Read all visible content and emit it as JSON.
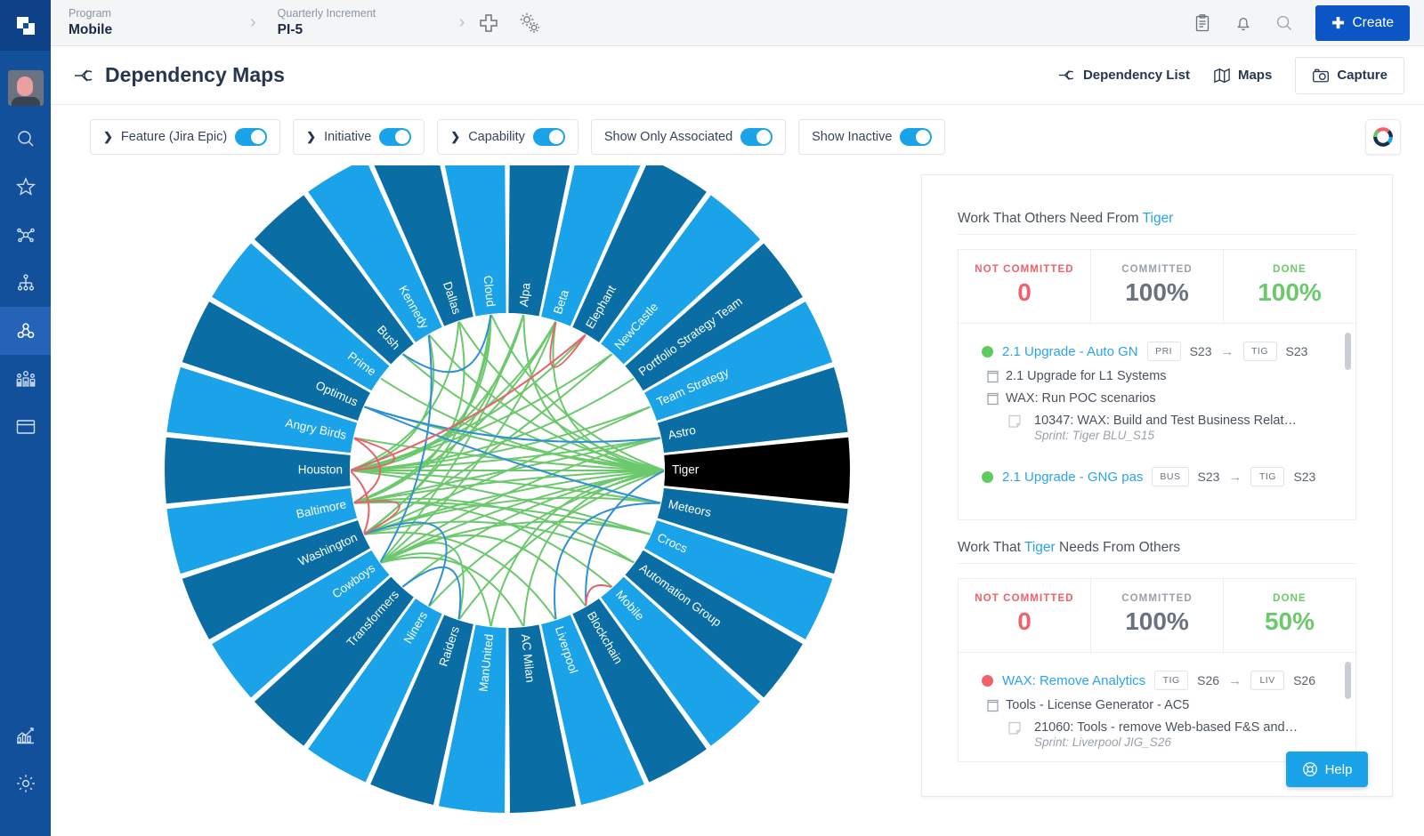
{
  "app": {
    "logo_icon": "jira-align-logo-icon"
  },
  "topbar": {
    "breadcrumbs": [
      {
        "label": "Program",
        "value": "Mobile"
      },
      {
        "label": "Quarterly Increment",
        "value": "PI-5"
      }
    ],
    "separator": "›",
    "add_icon": "plus-icon",
    "settings_icon": "gears-icon",
    "clipboard_icon": "clipboard-icon",
    "bell_icon": "bell-icon",
    "search_icon": "search-icon",
    "create_label": "Create",
    "create_icon": "plus-icon",
    "create_color": "#0b56c4"
  },
  "sidebar": {
    "avatar_name": "user-avatar",
    "items": [
      {
        "name": "search-icon",
        "active": false
      },
      {
        "name": "star-icon",
        "active": false
      },
      {
        "name": "network-hub-icon",
        "active": false
      },
      {
        "name": "org-hierarchy-icon",
        "active": false
      },
      {
        "name": "dependency-icon",
        "active": true
      },
      {
        "name": "people-team-icon",
        "active": false
      },
      {
        "name": "archive-box-icon",
        "active": false
      }
    ],
    "bottom_items": [
      {
        "name": "analytics-chart-icon"
      },
      {
        "name": "settings-gear-icon"
      }
    ],
    "bg_color": "#12509b",
    "active_color": "#2463b8"
  },
  "page": {
    "title": "Dependency Maps",
    "title_icon": "dependency-icon",
    "actions": [
      {
        "label": "Dependency List",
        "icon": "dependency-icon"
      },
      {
        "label": "Maps",
        "icon": "map-icon"
      },
      {
        "label": "Capture",
        "icon": "camera-icon"
      }
    ]
  },
  "filters": [
    {
      "label": "Feature (Jira Epic)",
      "has_chevron": true,
      "toggle_on": true
    },
    {
      "label": "Initiative",
      "has_chevron": true,
      "toggle_on": true
    },
    {
      "label": "Capability",
      "has_chevron": true,
      "toggle_on": true
    },
    {
      "label": "Show Only Associated",
      "has_chevron": false,
      "toggle_on": true
    },
    {
      "label": "Show Inactive",
      "has_chevron": false,
      "toggle_on": true
    }
  ],
  "color_wheel": {
    "icon": "color-wheel-icon"
  },
  "chart_data": {
    "type": "chord",
    "title": "Dependency Map",
    "selected_segment": "Tiger",
    "selected_color": "#000000",
    "ring_colors": [
      "#1aa3e8",
      "#0a6ea5"
    ],
    "segments": [
      "Kennedy",
      "Dallas",
      "Cloud",
      "Alpa",
      "Beta",
      "Elephant",
      "NewCastle",
      "Portfolio Strategy Team",
      "Team Strategy",
      "Astro",
      "Tiger",
      "Meteors",
      "Crocs",
      "Automation Group",
      "Mobile",
      "Blockchain",
      "Liverpool",
      "AC Milan",
      "ManUnited",
      "Raiders",
      "Niners",
      "Transformers",
      "Cowboys",
      "Washington",
      "Baltimore",
      "Houston",
      "Angry Birds",
      "Optimus",
      "Prime",
      "Bush"
    ],
    "link_colors": {
      "done": "#6cc86c",
      "in_progress": "#2f8fd6",
      "blocked": "#e8616b"
    },
    "link_counts": {
      "done": 52,
      "in_progress": 8,
      "blocked": 7
    }
  },
  "right_panel": {
    "sections": [
      {
        "heading_prefix": "Work That Others Need From ",
        "heading_team": "Tiger",
        "heading_suffix": "",
        "stats": [
          {
            "label": "NOT COMMITTED",
            "value": "0",
            "kind": "notcommitted"
          },
          {
            "label": "COMMITTED",
            "value": "100%",
            "kind": "committed"
          },
          {
            "label": "DONE",
            "value": "100%",
            "kind": "done"
          }
        ],
        "items": [
          {
            "status": "green",
            "title": "2.1 Upgrade - Auto GN",
            "from_team": "PRI",
            "from_sprint": "S23",
            "to_team": "TIG",
            "to_sprint": "S23",
            "children": [
              {
                "indent": 1,
                "icon": "feature-icon",
                "text": "2.1 Upgrade for L1 Systems"
              },
              {
                "indent": 1,
                "icon": "feature-icon",
                "text": "WAX: Run POC scenarios"
              },
              {
                "indent": 2,
                "icon": "story-icon",
                "text": "10347: WAX: Build and Test Business Relat…",
                "sprint": "Sprint: Tiger BLU_S15"
              }
            ]
          },
          {
            "status": "green",
            "title": "2.1 Upgrade - GNG pas",
            "from_team": "BUS",
            "from_sprint": "S23",
            "to_team": "TIG",
            "to_sprint": "S23",
            "children": []
          }
        ]
      },
      {
        "heading_prefix": "Work That ",
        "heading_team": "Tiger",
        "heading_suffix": " Needs From Others",
        "stats": [
          {
            "label": "NOT COMMITTED",
            "value": "0",
            "kind": "notcommitted"
          },
          {
            "label": "COMMITTED",
            "value": "100%",
            "kind": "committed"
          },
          {
            "label": "DONE",
            "value": "50%",
            "kind": "done"
          }
        ],
        "items": [
          {
            "status": "red",
            "title": "WAX: Remove Analytics",
            "from_team": "TIG",
            "from_sprint": "S26",
            "to_team": "LIV",
            "to_sprint": "S26",
            "children": [
              {
                "indent": 1,
                "icon": "feature-icon",
                "text": "Tools - License Generator - AC5"
              },
              {
                "indent": 2,
                "icon": "story-icon",
                "text": "21060: Tools - remove Web-based F&S and…",
                "sprint": "Sprint: Liverpool JIG_S26"
              }
            ]
          }
        ]
      }
    ],
    "arrow": "→"
  },
  "help": {
    "label": "Help",
    "icon": "lifebuoy-icon",
    "color": "#1aa3e8"
  }
}
